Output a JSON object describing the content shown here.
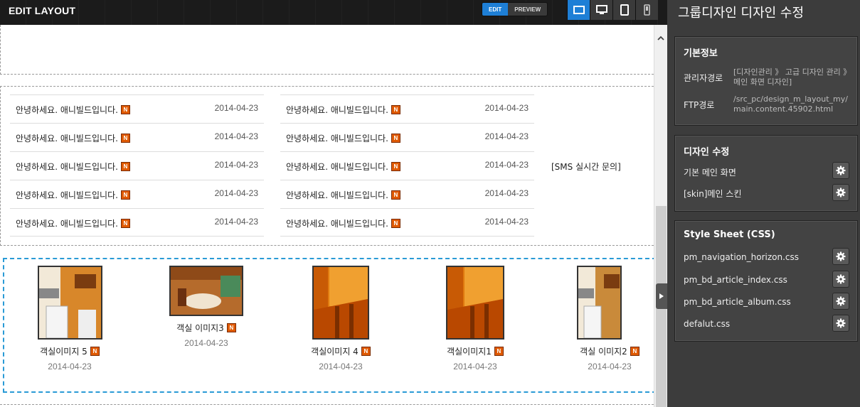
{
  "toolbar": {
    "title": "EDIT LAYOUT",
    "edit_label": "EDIT",
    "preview_label": "PREVIEW",
    "device_icons": [
      "wide-screen-icon",
      "desktop-icon",
      "tablet-icon",
      "mobile-icon"
    ],
    "accent": "#1e7fd6"
  },
  "board": {
    "left": [
      {
        "text": "안녕하세요. 애니빌드입니다.",
        "date": "2014-04-23",
        "badge": "N"
      },
      {
        "text": "안녕하세요. 애니빌드입니다.",
        "date": "2014-04-23",
        "badge": "N"
      },
      {
        "text": "안녕하세요. 애니빌드입니다.",
        "date": "2014-04-23",
        "badge": "N"
      },
      {
        "text": "안녕하세요. 애니빌드입니다.",
        "date": "2014-04-23",
        "badge": "N"
      },
      {
        "text": "안녕하세요. 애니빌드입니다.",
        "date": "2014-04-23",
        "badge": "N"
      }
    ],
    "right": [
      {
        "text": "안녕하세요. 애니빌드입니다.",
        "date": "2014-04-23",
        "badge": "N"
      },
      {
        "text": "안녕하세요. 애니빌드입니다.",
        "date": "2014-04-23",
        "badge": "N"
      },
      {
        "text": "안녕하세요. 애니빌드입니다.",
        "date": "2014-04-23",
        "badge": "N"
      },
      {
        "text": "안녕하세요. 애니빌드입니다.",
        "date": "2014-04-23",
        "badge": "N"
      },
      {
        "text": "안녕하세요. 애니빌드입니다.",
        "date": "2014-04-23",
        "badge": "N"
      }
    ],
    "sms_label": "[SMS 실시간 문의]"
  },
  "album": [
    {
      "caption": "객실이미지 5",
      "date": "2014-04-23",
      "badge": "N"
    },
    {
      "caption": "객실 이미지3",
      "date": "2014-04-23",
      "badge": "N"
    },
    {
      "caption": "객실이미지 4",
      "date": "2014-04-23",
      "badge": "N"
    },
    {
      "caption": "객실이미지1",
      "date": "2014-04-23",
      "badge": "N"
    },
    {
      "caption": "객실 이미지2",
      "date": "2014-04-23",
      "badge": "N"
    }
  ],
  "panel": {
    "title": "그룹디자인 디자인 수정",
    "basic": {
      "heading": "기본정보",
      "admin_path_label": "관리자경로",
      "admin_path_value": "[디자인관리 》 고급 디자인 관리 》 메인 화면 디자인]",
      "ftp_label": "FTP경로",
      "ftp_value": "/src_pc/design_m_layout_my/main.content.45902.html"
    },
    "design": {
      "heading": "디자인 수정",
      "items": [
        "기본 메인 화면",
        "[skin]메인 스킨"
      ]
    },
    "css": {
      "heading": "Style Sheet (CSS)",
      "items": [
        "pm_navigation_horizon.css",
        "pm_bd_article_index.css",
        "pm_bd_article_album.css",
        "defalut.css"
      ]
    }
  }
}
